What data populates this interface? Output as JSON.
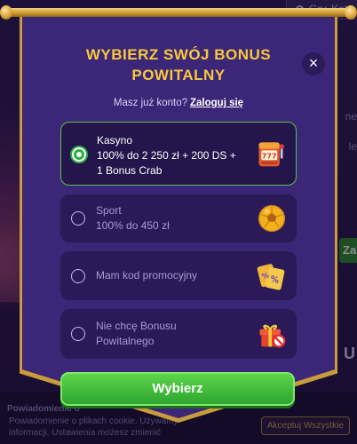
{
  "background": {
    "search_placeholder": "Gry, Kat",
    "right_text_1": "ne",
    "right_text_2": "le",
    "right_button": "Za",
    "right_heading": "U",
    "cookie_title": "Powiadomienie o",
    "cookie_line_1": "Powiadomienie o plikach cookie. Używamy",
    "cookie_line_2": "informacji. Ustawienia możesz zmienić",
    "cookie_button": "Akceptuj Wszystkie"
  },
  "modal": {
    "title": "WYBIERZ SWÓJ BONUS POWITALNY",
    "close_label": "×",
    "account_prompt": "Masz już konto?",
    "login_link": "Zaloguj się",
    "options": [
      {
        "title": "Kasyno",
        "text": "100% do 2 250 zł + 200 DS + 1 Bonus Crab",
        "selected": true,
        "icon": "slot-machine-icon"
      },
      {
        "title": "Sport",
        "text": "100% do 450 zł",
        "selected": false,
        "icon": "soccer-ball-icon"
      },
      {
        "title": "",
        "text": "Mam kod promocyjny",
        "selected": false,
        "icon": "promo-code-icon"
      },
      {
        "title": "",
        "text": "Nie chcę Bonusu Powitalnego",
        "selected": false,
        "icon": "no-gift-icon"
      }
    ],
    "submit_label": "Wybierz"
  },
  "colors": {
    "accent_gold": "#f7c93c",
    "modal_bg": "#3c2678",
    "option_bg": "#2b1a57",
    "selected_border": "#55c44a",
    "button_green": "#2ea52f"
  }
}
